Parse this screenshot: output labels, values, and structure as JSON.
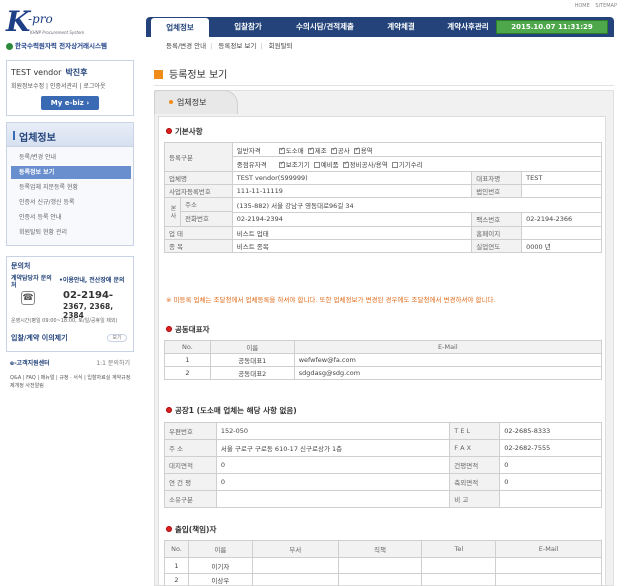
{
  "top_links": [
    "HOME",
    "SITEMAP"
  ],
  "logo": {
    "k": "K",
    "pro": "-pro",
    "subtitle": "KHNP Procurement System",
    "org": "한국수력원자력 전자상거래시스템"
  },
  "nav": {
    "tabs": [
      "업체정보",
      "입찰참가",
      "수의시담/견적제출",
      "계약체결",
      "계약사후관리"
    ],
    "clock": "2015.10.07  11:31:29"
  },
  "subnav": [
    "등록/변경 안내",
    "등록정보 보기",
    "회원탈퇴"
  ],
  "user": {
    "label": "TEST vendor",
    "name": "박진후",
    "links": "회원정보수정  |  인증서관리  |  로그아웃",
    "myebiz": "My e-biz  ›"
  },
  "menu": {
    "title": "업체정보",
    "items": [
      "등록/변경 안내",
      "등록정보 보기",
      "등록업체 지문등록 현황",
      "인증서 신규/갱신 등록",
      "인증서 등록 안내",
      "회원탈퇴 현황 관리"
    ]
  },
  "contact": {
    "title": "문의처",
    "who": "계약담당자 문의처",
    "who2": "•이용안내, 전산장애 문의",
    "phone1": "02-2194-",
    "phone2": "2367, 2368, 2384",
    "hours": "운영시간(평일 09:00~18:00, 토/일/공휴일 제외)",
    "inquiry": "입찰/계약 이의제기",
    "inquiry_btn": "보기"
  },
  "help": {
    "title": "e-고객지원센터",
    "right": "1:1 문의하기",
    "text": "Q&A | FAQ | 매뉴얼 | 규정 · 서식 | 입찰자료실 계약규정 제개정 사전알림"
  },
  "page": {
    "title": "등록정보 보기",
    "tab": "업체정보"
  },
  "basic": {
    "title": "기본사항",
    "reg_type_label": "등록구분",
    "general_qual_label": "일반자격",
    "general_qual": [
      {
        "label": "도소매",
        "checked": true
      },
      {
        "label": "제조",
        "checked": true
      },
      {
        "label": "공사",
        "checked": true
      },
      {
        "label": "용역",
        "checked": true
      }
    ],
    "joint_qual_label": "중점유자격",
    "joint_qual": [
      {
        "label": "보조기기",
        "checked": true
      },
      {
        "label": "예비품",
        "checked": false
      },
      {
        "label": "정비공사/용역",
        "checked": true
      },
      {
        "label": "기기수리",
        "checked": false
      }
    ],
    "company_label": "업체명",
    "company": "TEST vendor(S99999)",
    "ceo_label": "대표자명",
    "ceo": "TEST",
    "bizno_label": "사업자등록번호",
    "bizno": "111-11-11119",
    "corpno_label": "법인번호",
    "corpno": "",
    "jp_label": "본 사",
    "addr_label": "주소",
    "addr": "(135-882) 서울 강남구 영동대로96길 34",
    "tel_label": "전화번호",
    "tel": "02-2194-2394",
    "fax_label": "팩스번호",
    "fax": "02-2194-2366",
    "biztype_label": "업 태",
    "biztype": "비스트 업태",
    "homepage_label": "홈페이지",
    "homepage": "",
    "bizitem_label": "종 목",
    "bizitem": "비스트 종목",
    "years_label": "실업연도",
    "years": "0000 년"
  },
  "notice": "※ 미등록 업체는 조달청에서 업체등록을 하셔야 합니다. 또한 업체정보가 변경된 경우에도 조달청에서 변경하셔야 합니다.",
  "joint": {
    "title": "공동대표자",
    "headers": [
      "No.",
      "이름",
      "E-Mail"
    ],
    "rows": [
      [
        "1",
        "공동대표1",
        "wefwfew@fa.com"
      ],
      [
        "2",
        "공동대표2",
        "sdgdasg@sdg.com"
      ]
    ]
  },
  "factory": {
    "title": "공장1 (도소매 업체는 해당 사항 없음)",
    "zip_label": "우편번호",
    "zip": "152-050",
    "tel_label": "T E L",
    "tel": "02-2685-8333",
    "addr_label": "주 소",
    "addr": "서울 구로구 구로동 610-17 신구로상가 1층",
    "fax_label": "F A X",
    "fax": "02-2682-7555",
    "site_label": "대지면적",
    "site": "0",
    "bldg_label": "건평면적",
    "bldg": "0",
    "annual_label": "연 건 평",
    "annual": "0",
    "prod_label": "축외면적",
    "prod": "0",
    "own_label": "소유구분",
    "own": "",
    "memo_label": "비 고",
    "memo": ""
  },
  "person": {
    "title": "출입(책임)자",
    "headers": [
      "No.",
      "이름",
      "부서",
      "직책",
      "Tel",
      "E-Mail"
    ],
    "rows": [
      [
        "1",
        "이기자",
        "",
        "",
        "",
        ""
      ],
      [
        "2",
        "이상우",
        "",
        "",
        "",
        ""
      ]
    ]
  }
}
